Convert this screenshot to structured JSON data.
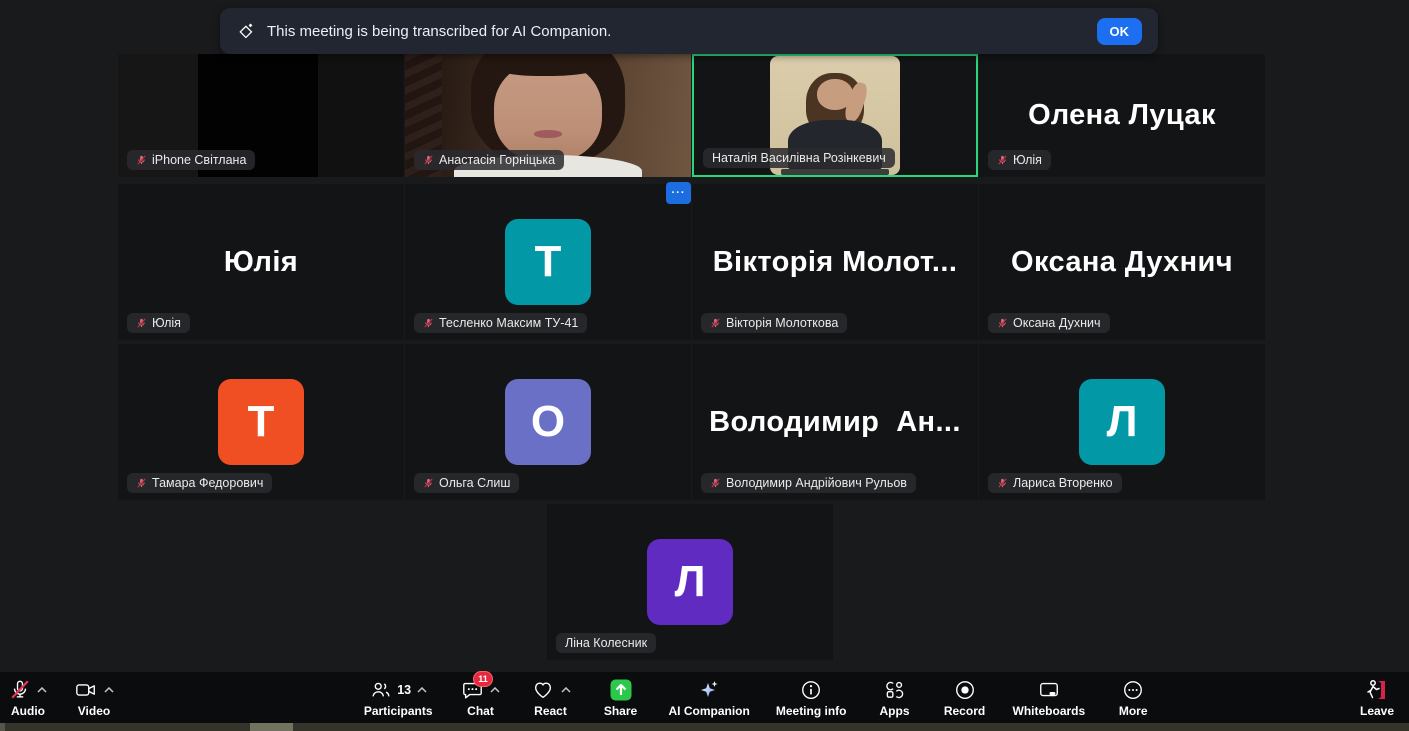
{
  "banner": {
    "text": "This meeting is being transcribed for AI Companion.",
    "ok_label": "OK",
    "accent": "#1d6ff2"
  },
  "gallery": {
    "more_button_dots": "···",
    "active_border_color": "#2bd57a",
    "participants": [
      {
        "label": "iPhone Світлана",
        "muted": true,
        "type": "video-dark"
      },
      {
        "label": "Анастасія Горніцька",
        "muted": true,
        "type": "video-face"
      },
      {
        "label": "Наталія Василівна Розінкевич",
        "muted": false,
        "active": true,
        "type": "video-portrait"
      },
      {
        "label": "Олена Луцак",
        "display": "Олена Луцак",
        "muted": true,
        "type": "name"
      },
      {
        "label": "Юлія",
        "display": "Юлія",
        "muted": true,
        "type": "name"
      },
      {
        "label": "Тесленко Максим ТУ-41",
        "initial": "Т",
        "color": "#0398a6",
        "muted": true,
        "type": "avatar"
      },
      {
        "label": "Вікторія Молоткова",
        "display": "Вікторія Молот...",
        "muted": true,
        "type": "name"
      },
      {
        "label": "Оксана Духнич",
        "display": "Оксана Духнич",
        "muted": true,
        "type": "name"
      },
      {
        "label": "Тамара Федорович",
        "initial": "Т",
        "color": "#f04f23",
        "muted": true,
        "type": "avatar"
      },
      {
        "label": "Ольга Слиш",
        "initial": "О",
        "color": "#6970c5",
        "muted": true,
        "type": "avatar"
      },
      {
        "label": "Володимир Андрійович Рульов",
        "display": "Володимир  Ан...",
        "muted": true,
        "type": "name"
      },
      {
        "label": "Лариса Вторенко",
        "initial": "Л",
        "color": "#0398a6",
        "muted": true,
        "type": "avatar"
      },
      {
        "label": "Ліна Колесник",
        "initial": "Л",
        "color": "#5f2bc0",
        "muted": false,
        "type": "avatar"
      }
    ]
  },
  "toolbar": {
    "items": [
      {
        "id": "audio",
        "label": "Audio",
        "muted": true
      },
      {
        "id": "video",
        "label": "Video"
      },
      {
        "id": "participants",
        "label": "Participants",
        "count": "13"
      },
      {
        "id": "chat",
        "label": "Chat",
        "badge": "11"
      },
      {
        "id": "react",
        "label": "React"
      },
      {
        "id": "share",
        "label": "Share",
        "color": "#2bc84c"
      },
      {
        "id": "ai-companion",
        "label": "AI Companion"
      },
      {
        "id": "meeting-info",
        "label": "Meeting info"
      },
      {
        "id": "apps",
        "label": "Apps"
      },
      {
        "id": "record",
        "label": "Record"
      },
      {
        "id": "whiteboards",
        "label": "Whiteboards"
      },
      {
        "id": "more",
        "label": "More"
      },
      {
        "id": "leave",
        "label": "Leave",
        "color": "#d6234a"
      }
    ],
    "badge_color": "#e8273f",
    "share_color": "#2bc84c",
    "leave_door_color": "#d6234a"
  }
}
